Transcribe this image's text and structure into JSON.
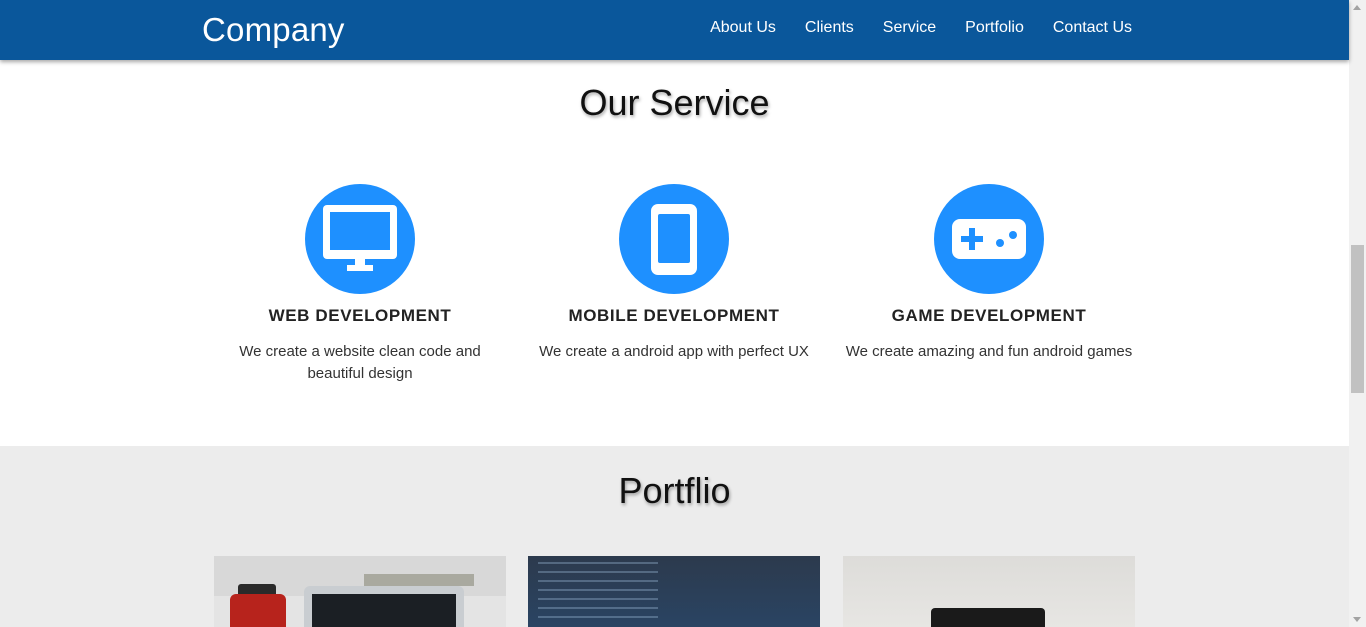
{
  "navbar": {
    "brand": "Company",
    "links": [
      "About Us",
      "Clients",
      "Service",
      "Portfolio",
      "Contact Us"
    ],
    "background_color": "#0a579b"
  },
  "service": {
    "title": "Our Service",
    "accent_color": "#1e90ff",
    "items": [
      {
        "icon": "desktop-monitor-icon",
        "heading": "WEB DEVELOPMENT",
        "text": "We create a website clean code and beautiful design"
      },
      {
        "icon": "mobile-phone-icon",
        "heading": "MOBILE DEVELOPMENT",
        "text": "We create a android app with perfect UX"
      },
      {
        "icon": "gamepad-icon",
        "heading": "GAME DEVELOPMENT",
        "text": "We create amazing and fun android games"
      }
    ]
  },
  "portfolio": {
    "title": "Portflio",
    "background_color": "#ececec",
    "images": [
      "portfolio-image-laptop-desk",
      "portfolio-image-code-screen",
      "portfolio-image-device-white"
    ]
  }
}
